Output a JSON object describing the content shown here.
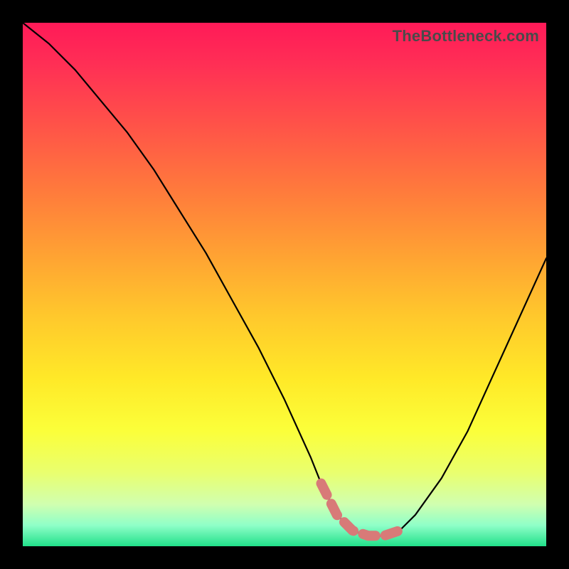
{
  "watermark": "TheBottleneck.com",
  "colors": {
    "background": "#000000",
    "curve": "#000000",
    "accent": "#d87a78",
    "gradient_top": "#ff1a58",
    "gradient_bottom": "#21e08a"
  },
  "chart_data": {
    "type": "line",
    "title": "",
    "xlabel": "",
    "ylabel": "",
    "xlim": [
      0,
      100
    ],
    "ylim": [
      0,
      100
    ],
    "series": [
      {
        "name": "bottleneck-curve",
        "x": [
          0,
          5,
          10,
          15,
          20,
          25,
          30,
          35,
          40,
          45,
          50,
          55,
          57,
          60,
          63,
          66,
          69,
          72,
          75,
          80,
          85,
          90,
          95,
          100
        ],
        "y": [
          100,
          96,
          91,
          85,
          79,
          72,
          64,
          56,
          47,
          38,
          28,
          17,
          12,
          6,
          3,
          2,
          2,
          3,
          6,
          13,
          22,
          33,
          44,
          55
        ]
      }
    ],
    "highlight": {
      "name": "valley-highlight",
      "x": [
        57,
        60,
        63,
        66,
        69,
        72
      ],
      "y": [
        12,
        6,
        3,
        2,
        2,
        3
      ]
    }
  }
}
